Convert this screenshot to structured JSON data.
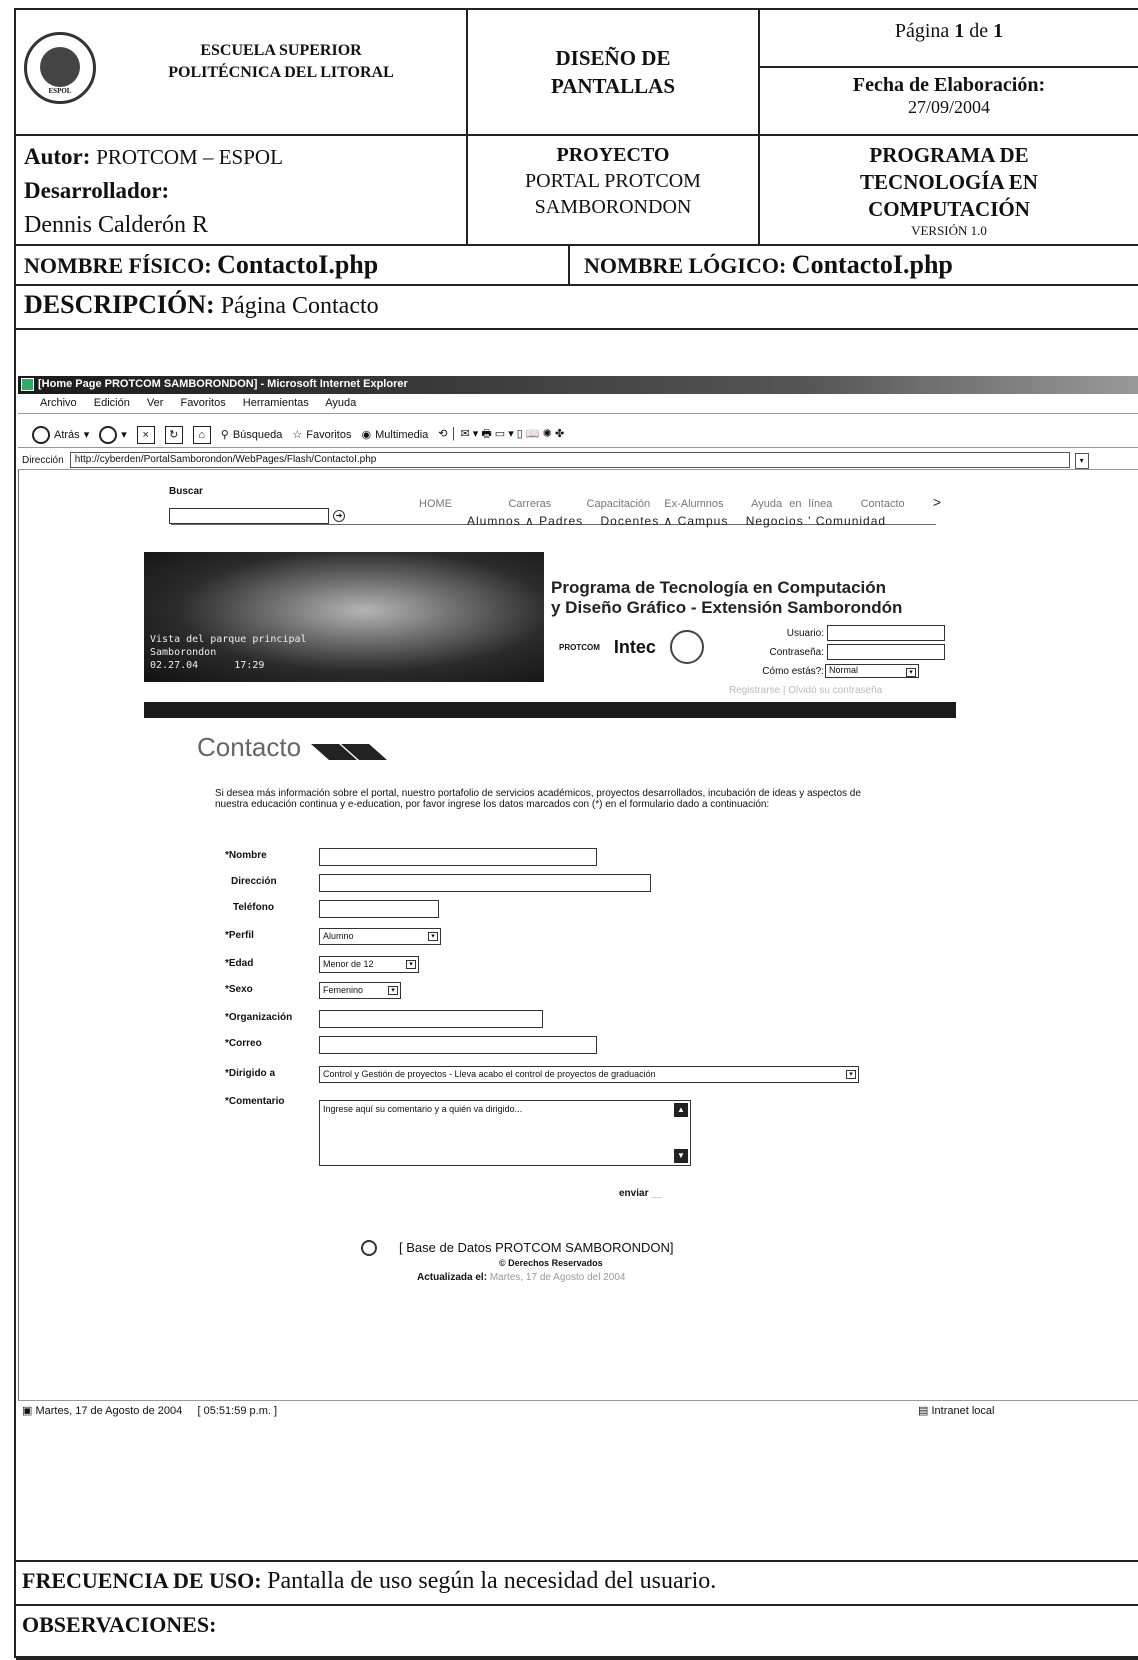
{
  "header": {
    "institution": [
      "ESCUELA SUPERIOR",
      "POLITÉCNICA DEL LITORAL"
    ],
    "doc_title": [
      "DISEÑO DE",
      "PANTALLAS"
    ],
    "page_label": "Página",
    "page_num": "1",
    "page_of": "de",
    "page_total": "1",
    "date_label": "Fecha de Elaboración:",
    "date_value": "27/09/2004",
    "author_label": "Autor:",
    "author_value": "PROTCOM – ESPOL",
    "developer_label": "Desarrollador:",
    "developer_value": "Dennis Calderón R",
    "project_label": "PROYECTO",
    "project_value": [
      "PORTAL PROTCOM",
      "SAMBORONDON"
    ],
    "program": [
      "PROGRAMA DE",
      "TECNOLOGÍA EN",
      "COMPUTACIÓN"
    ],
    "version": "VERSIÓN 1.0",
    "physical_name_label": "NOMBRE FÍSICO:",
    "physical_name_value": "ContactoI.php",
    "logical_name_label": "NOMBRE LÓGICO:",
    "logical_name_value": "ContactoI.php",
    "description_label": "DESCRIPCIÓN:",
    "description_value": "Página Contacto",
    "logo_text": "ESPOL"
  },
  "browser": {
    "title": "[Home Page PROTCOM SAMBORONDON] - Microsoft Internet Explorer",
    "menu": [
      "Archivo",
      "Edición",
      "Ver",
      "Favoritos",
      "Herramientas",
      "Ayuda"
    ],
    "toolbar": {
      "back": "Atrás",
      "search": "Búsqueda",
      "favorites": "Favoritos",
      "multimedia": "Multimedia"
    },
    "address_label": "Dirección",
    "address_value": "http://cyberden/PortalSamborondon/WebPages/Flash/ContactoI.php",
    "status_date": "Martes, 17 de Agosto de 2004",
    "status_time": "[ 05:51:59 p.m. ]",
    "status_zone": "Intranet local"
  },
  "site": {
    "search_label": "Buscar",
    "nav1": [
      "HOME",
      "Carreras",
      "Capacitación",
      "Ex-Alumnos",
      "Ayuda en línea",
      "Contacto",
      ">"
    ],
    "nav2": [
      "Alumnos",
      "Padres",
      "Docentes",
      "Campus",
      "Negocios",
      "Comunidad"
    ],
    "photo_caption": "Vista del parque principal\nSamborondon\n02.27.04      17:29",
    "program_title": [
      "Programa de Tecnología en Computación",
      "y Diseño Gráfico - Extensión Samborondón"
    ],
    "logos": [
      "PROTCOM",
      "Intec",
      "ESPOL"
    ],
    "login_user": "Usuario:",
    "login_pass": "Contraseña:",
    "login_mood": "Cómo estás?:",
    "login_mood_value": "Normal",
    "login_links": "Registrarse | Olvidó su contraseña",
    "contact_heading": "Contacto",
    "intro": "Si desea más información sobre el portal, nuestro portafolio de servicios académicos, proyectos desarrollados, incubación de ideas y aspectos de nuestra educación continua y e-education, por favor ingrese los datos marcados con (*) en el formulario dado a continuación:",
    "form": {
      "nombre": "*Nombre",
      "direccion": "Dirección",
      "telefono": "Teléfono",
      "perfil": "*Perfil",
      "perfil_value": "Alumno",
      "edad": "*Edad",
      "edad_value": "Menor de 12",
      "sexo": "*Sexo",
      "sexo_value": "Femenino",
      "organizacion": "*Organización",
      "correo": "*Correo",
      "dirigido": "*Dirigido a",
      "dirigido_value": "Control y Gestión de proyectos - Lleva acabo el control de proyectos de graduación",
      "comentario": "*Comentario",
      "comentario_placeholder": "Ingrese aquí su comentario y a quién va dirigido...",
      "send": "enviar"
    },
    "footer_db": "[ Base de Datos PROTCOM SAMBORONDON]",
    "footer_rights": "© Derechos Reservados",
    "footer_updated_label": "Actualizada el:",
    "footer_updated_value": "Martes, 17 de Agosto del 2004"
  },
  "bottom": {
    "freq_label": "FRECUENCIA DE USO:",
    "freq_value": "Pantalla de uso según la necesidad del usuario.",
    "obs_label": "OBSERVACIONES:"
  }
}
